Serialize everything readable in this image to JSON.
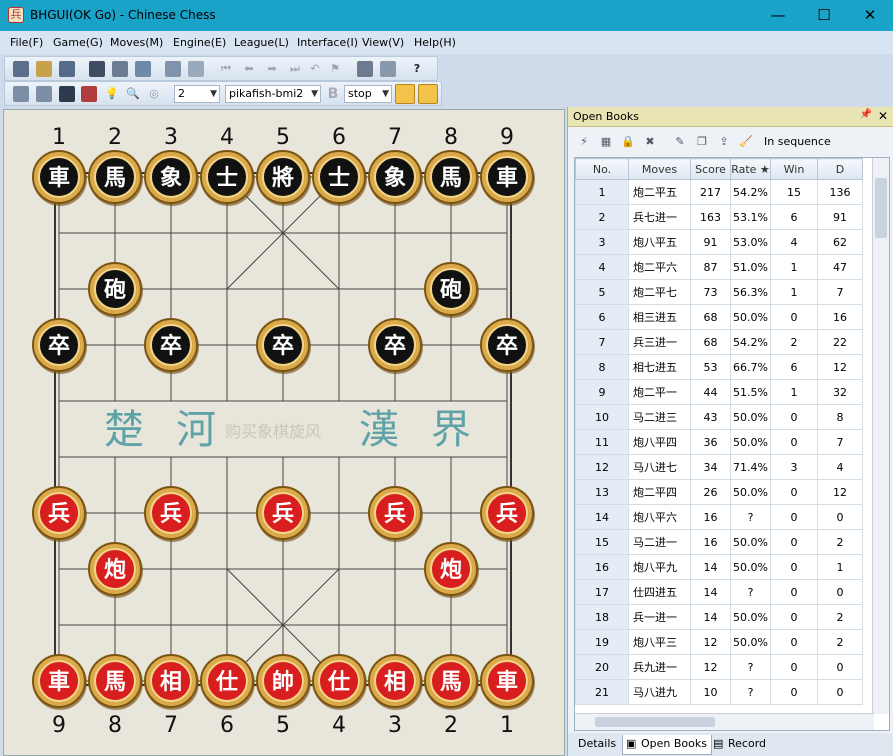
{
  "window": {
    "title": "BHGUI(OK Go) - Chinese Chess",
    "app_icon_glyph": "兵",
    "minimize": "—",
    "maximize": "☐",
    "close": "✕"
  },
  "menu": [
    "File(F)",
    "Game(G)",
    "Moves(M)",
    "Engine(E)",
    "League(L)",
    "Interface(I)",
    "View(V)",
    "Help(H)"
  ],
  "toolbar": {
    "help_glyph": "?",
    "depth_value": "2",
    "engine_value": "pikafish-bmi2",
    "mode_glyph": "B",
    "state_value": "stop"
  },
  "board": {
    "top_files": [
      "1",
      "2",
      "3",
      "4",
      "5",
      "6",
      "7",
      "8",
      "9"
    ],
    "bottom_files": [
      "9",
      "8",
      "7",
      "6",
      "5",
      "4",
      "3",
      "2",
      "1"
    ],
    "river_left": [
      "楚",
      "河"
    ],
    "river_right": [
      "漢",
      "界"
    ],
    "watermark": "购买象棋旋风",
    "pieces": [
      {
        "side": "black",
        "char": "車",
        "file": 0,
        "rank": 0
      },
      {
        "side": "black",
        "char": "馬",
        "file": 1,
        "rank": 0
      },
      {
        "side": "black",
        "char": "象",
        "file": 2,
        "rank": 0
      },
      {
        "side": "black",
        "char": "士",
        "file": 3,
        "rank": 0
      },
      {
        "side": "black",
        "char": "將",
        "file": 4,
        "rank": 0
      },
      {
        "side": "black",
        "char": "士",
        "file": 5,
        "rank": 0
      },
      {
        "side": "black",
        "char": "象",
        "file": 6,
        "rank": 0
      },
      {
        "side": "black",
        "char": "馬",
        "file": 7,
        "rank": 0
      },
      {
        "side": "black",
        "char": "車",
        "file": 8,
        "rank": 0
      },
      {
        "side": "black",
        "char": "砲",
        "file": 1,
        "rank": 2
      },
      {
        "side": "black",
        "char": "砲",
        "file": 7,
        "rank": 2
      },
      {
        "side": "black",
        "char": "卒",
        "file": 0,
        "rank": 3
      },
      {
        "side": "black",
        "char": "卒",
        "file": 2,
        "rank": 3
      },
      {
        "side": "black",
        "char": "卒",
        "file": 4,
        "rank": 3
      },
      {
        "side": "black",
        "char": "卒",
        "file": 6,
        "rank": 3
      },
      {
        "side": "black",
        "char": "卒",
        "file": 8,
        "rank": 3
      },
      {
        "side": "red",
        "char": "兵",
        "file": 0,
        "rank": 6
      },
      {
        "side": "red",
        "char": "兵",
        "file": 2,
        "rank": 6
      },
      {
        "side": "red",
        "char": "兵",
        "file": 4,
        "rank": 6
      },
      {
        "side": "red",
        "char": "兵",
        "file": 6,
        "rank": 6
      },
      {
        "side": "red",
        "char": "兵",
        "file": 8,
        "rank": 6
      },
      {
        "side": "red",
        "char": "炮",
        "file": 1,
        "rank": 7
      },
      {
        "side": "red",
        "char": "炮",
        "file": 7,
        "rank": 7
      },
      {
        "side": "red",
        "char": "車",
        "file": 0,
        "rank": 9
      },
      {
        "side": "red",
        "char": "馬",
        "file": 1,
        "rank": 9
      },
      {
        "side": "red",
        "char": "相",
        "file": 2,
        "rank": 9
      },
      {
        "side": "red",
        "char": "仕",
        "file": 3,
        "rank": 9
      },
      {
        "side": "red",
        "char": "帥",
        "file": 4,
        "rank": 9
      },
      {
        "side": "red",
        "char": "仕",
        "file": 5,
        "rank": 9
      },
      {
        "side": "red",
        "char": "相",
        "file": 6,
        "rank": 9
      },
      {
        "side": "red",
        "char": "馬",
        "file": 7,
        "rank": 9
      },
      {
        "side": "red",
        "char": "車",
        "file": 8,
        "rank": 9
      }
    ]
  },
  "panel": {
    "title": "Open Books",
    "pin_glyph": "📌",
    "close_glyph": "✕",
    "sequence_label": "In sequence",
    "columns": [
      "No.",
      "Moves",
      "Score",
      "Rate ★",
      "Win",
      "D"
    ],
    "rows": [
      [
        "1",
        "炮二平五",
        "217",
        "54.2%",
        "15",
        "136"
      ],
      [
        "2",
        "兵七进一",
        "163",
        "53.1%",
        "6",
        "91"
      ],
      [
        "3",
        "炮八平五",
        "91",
        "53.0%",
        "4",
        "62"
      ],
      [
        "4",
        "炮二平六",
        "87",
        "51.0%",
        "1",
        "47"
      ],
      [
        "5",
        "炮二平七",
        "73",
        "56.3%",
        "1",
        "7"
      ],
      [
        "6",
        "相三进五",
        "68",
        "50.0%",
        "0",
        "16"
      ],
      [
        "7",
        "兵三进一",
        "68",
        "54.2%",
        "2",
        "22"
      ],
      [
        "8",
        "相七进五",
        "53",
        "66.7%",
        "6",
        "12"
      ],
      [
        "9",
        "炮二平一",
        "44",
        "51.5%",
        "1",
        "32"
      ],
      [
        "10",
        "马二进三",
        "43",
        "50.0%",
        "0",
        "8"
      ],
      [
        "11",
        "炮八平四",
        "36",
        "50.0%",
        "0",
        "7"
      ],
      [
        "12",
        "马八进七",
        "34",
        "71.4%",
        "3",
        "4"
      ],
      [
        "13",
        "炮二平四",
        "26",
        "50.0%",
        "0",
        "12"
      ],
      [
        "14",
        "炮八平六",
        "16",
        "?",
        "0",
        "0"
      ],
      [
        "15",
        "马二进一",
        "16",
        "50.0%",
        "0",
        "2"
      ],
      [
        "16",
        "炮八平九",
        "14",
        "50.0%",
        "0",
        "1"
      ],
      [
        "17",
        "仕四进五",
        "14",
        "?",
        "0",
        "0"
      ],
      [
        "18",
        "兵一进一",
        "14",
        "50.0%",
        "0",
        "2"
      ],
      [
        "19",
        "炮八平三",
        "12",
        "50.0%",
        "0",
        "2"
      ],
      [
        "20",
        "兵九进一",
        "12",
        "?",
        "0",
        "0"
      ],
      [
        "21",
        "马八进九",
        "10",
        "?",
        "0",
        "0"
      ]
    ],
    "tabs": [
      "Details",
      "Open Books",
      "Record"
    ]
  },
  "colors": {
    "titlebar": "#1aa3c8",
    "red_piece": "#d81e1e",
    "black_piece": "#111111",
    "river_text": "#5fa3a8"
  }
}
